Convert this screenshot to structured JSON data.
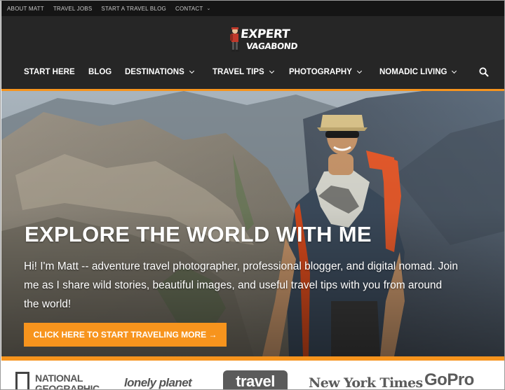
{
  "topbar": {
    "items": [
      {
        "label": "ABOUT MATT"
      },
      {
        "label": "TRAVEL JOBS"
      },
      {
        "label": "START A TRAVEL BLOG"
      },
      {
        "label": "CONTACT"
      }
    ]
  },
  "logo": {
    "line1": "EXPERT",
    "line2": "VAGABOND"
  },
  "nav": {
    "items": [
      {
        "label": "START HERE"
      },
      {
        "label": "BLOG"
      },
      {
        "label": "DESTINATIONS"
      },
      {
        "label": "TRAVEL TIPS"
      },
      {
        "label": "PHOTOGRAPHY"
      },
      {
        "label": "NOMADIC LIVING"
      }
    ],
    "search_icon": "search-icon"
  },
  "hero": {
    "title": "EXPLORE THE WORLD WITH ME",
    "text": "Hi! I'm Matt -- adventure travel photographer, professional blogger, and digital nomad. Join me as I share wild stories, beautiful images, and useful travel tips with you from around the world!",
    "cta": "CLICK HERE TO START TRAVELING MORE →"
  },
  "press": {
    "natgeo_1": "NATIONAL",
    "natgeo_2": "GEOGRAPHIC",
    "lonely": "lonely planet",
    "travel": "travel",
    "nyt": "New York Times",
    "gopro": "GoPro"
  },
  "colors": {
    "accent": "#f7941d",
    "header": "#262626",
    "topbar": "#151515"
  }
}
